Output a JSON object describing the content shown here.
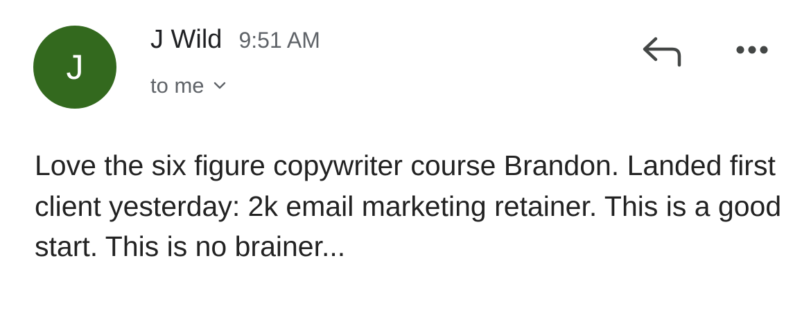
{
  "message": {
    "sender": {
      "initial": "J",
      "name": "J Wild",
      "avatar_color": "#33691e"
    },
    "time": "9:51 AM",
    "recipient": "to me",
    "icons": {
      "reply": "reply-icon",
      "more": "more-horizontal-icon",
      "expand": "chevron-down-icon"
    },
    "body": "Love the six figure copywriter course Brandon. Landed first client yesterday: 2k email marketing retainer. This is a good start. This is no brainer..."
  }
}
